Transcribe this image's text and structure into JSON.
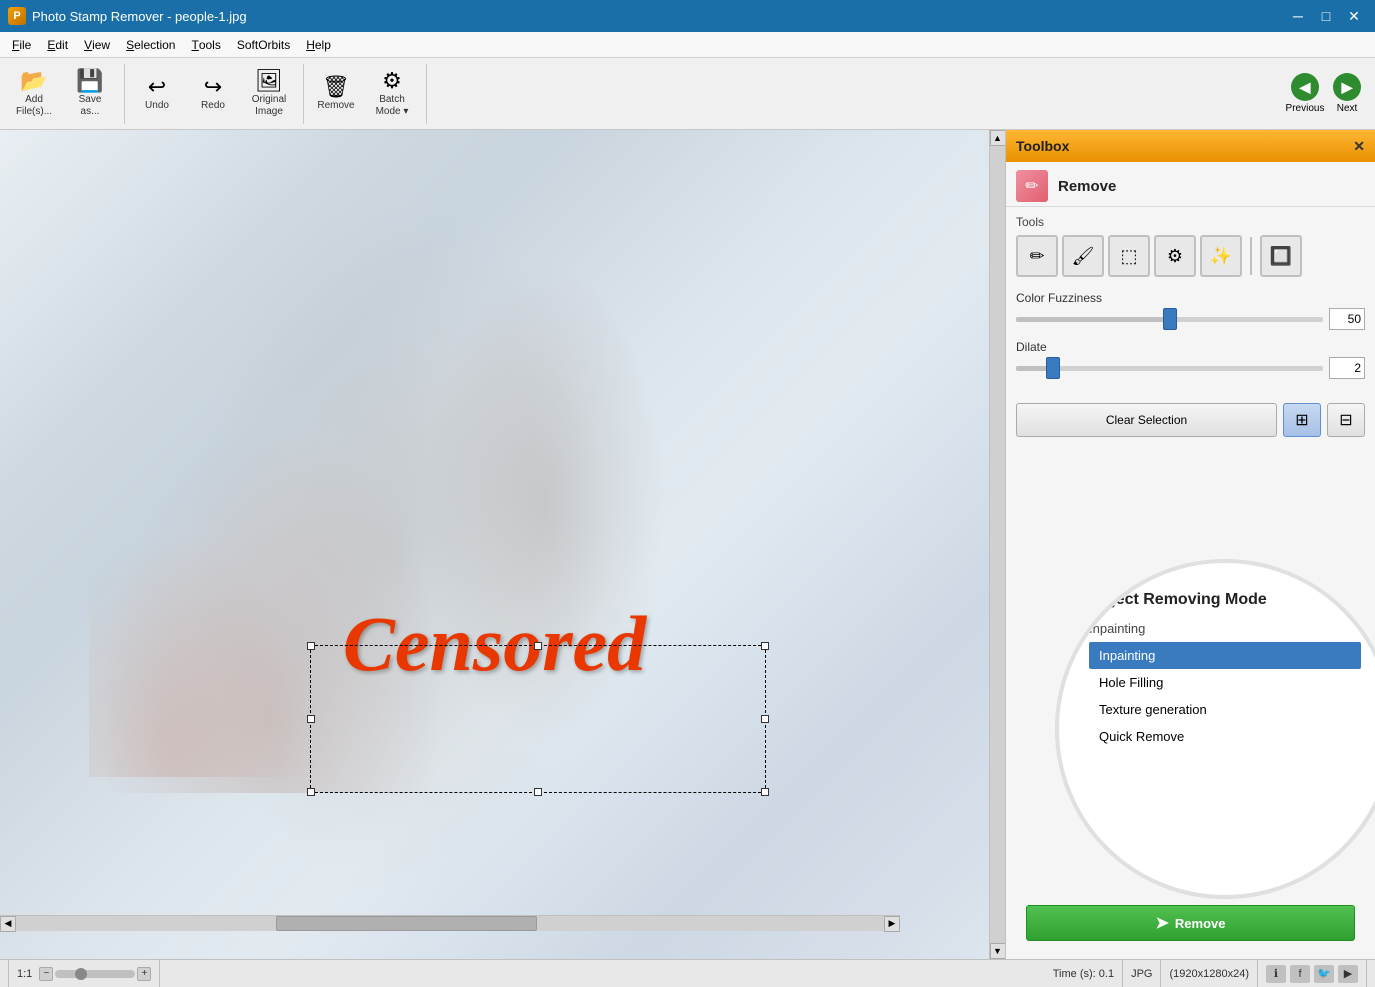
{
  "titleBar": {
    "appIcon": "📷",
    "title": "Photo Stamp Remover - people-1.jpg",
    "minimizeIcon": "─",
    "maximizeIcon": "□",
    "closeIcon": "✕"
  },
  "menuBar": {
    "items": [
      {
        "label": "File",
        "underlineIndex": 0
      },
      {
        "label": "Edit",
        "underlineIndex": 0
      },
      {
        "label": "View",
        "underlineIndex": 0
      },
      {
        "label": "Selection",
        "underlineIndex": 0
      },
      {
        "label": "Tools",
        "underlineIndex": 0
      },
      {
        "label": "SoftOrbits",
        "underlineIndex": 0
      },
      {
        "label": "Help",
        "underlineIndex": 0
      }
    ]
  },
  "toolbar": {
    "addFiles": "Add\nFile(s)...",
    "saveAs": "Save\nas...",
    "undo": "Undo",
    "redo": "Redo",
    "originalImage": "Original\nImage",
    "remove": "Remove",
    "batchMode": "Batch\nMode",
    "previous": "Previous",
    "next": "Next"
  },
  "toolbox": {
    "title": "Toolbox",
    "close": "✕",
    "removeLabel": "Remove",
    "toolsLabel": "Tools",
    "colorFuzziness": {
      "label": "Color Fuzziness",
      "value": 50,
      "percent": 50
    },
    "dilate": {
      "label": "Dilate",
      "value": 2,
      "percent": 12
    },
    "clearSelectionLabel": "Clear Selection",
    "objectRemovingMode": {
      "title": "Object Removing Mode",
      "currentLabel": "Inpainting",
      "options": [
        {
          "label": "Inpainting",
          "selected": true
        },
        {
          "label": "Hole Filling",
          "selected": false
        },
        {
          "label": "Texture generation",
          "selected": false
        },
        {
          "label": "Quick Remove",
          "selected": false
        }
      ]
    },
    "removeButton": "Remove"
  },
  "canvas": {
    "censoredText": "Censored"
  },
  "statusBar": {
    "zoom": "1:1",
    "zoomIcon": "🔍",
    "time": "Time (s): 0.1",
    "format": "JPG",
    "dimensions": "(1920x1280x24)",
    "infoIcon": "ℹ",
    "facebookIcon": "f",
    "twitterIcon": "🐦",
    "youtubeIcon": "▶"
  }
}
